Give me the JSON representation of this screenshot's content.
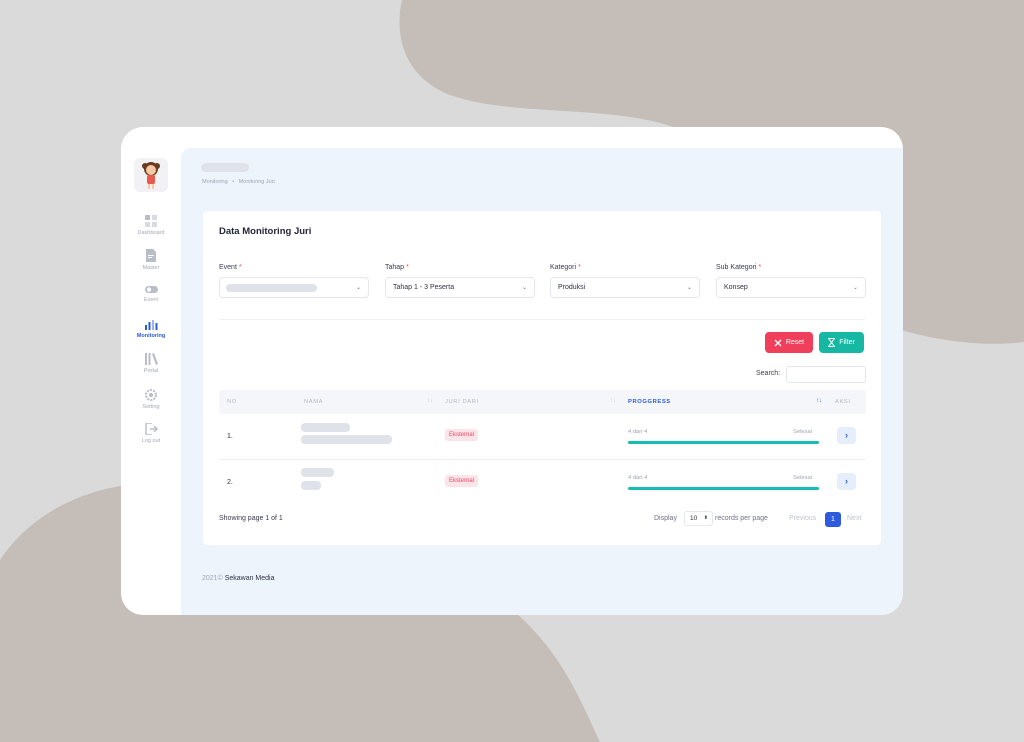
{
  "sidebar": {
    "items": [
      {
        "label": "Dashboard",
        "icon": "dashboard-icon"
      },
      {
        "label": "Master",
        "icon": "document-icon"
      },
      {
        "label": "Event",
        "icon": "toggle-icon"
      },
      {
        "label": "Monitoring",
        "icon": "bar-chart-icon",
        "active": true
      },
      {
        "label": "Portal",
        "icon": "library-icon"
      },
      {
        "label": "Setting",
        "icon": "gear-icon"
      },
      {
        "label": "Log out",
        "icon": "logout-icon"
      }
    ]
  },
  "breadcrumb": {
    "items": [
      "Monitoring",
      "•",
      "Monitoring Juri"
    ]
  },
  "card": {
    "title": "Data Monitoring Juri"
  },
  "filters": {
    "event": {
      "label": "Event",
      "value": ""
    },
    "tahap": {
      "label": "Tahap",
      "value": "Tahap 1 - 3 Peserta"
    },
    "kategori": {
      "label": "Kategori",
      "value": "Produksi"
    },
    "subkategori": {
      "label": "Sub Kategori",
      "value": "Konsep"
    },
    "required_mark": "*",
    "chevron": "⌄"
  },
  "buttons": {
    "reset": "Reset",
    "filter": "Filter"
  },
  "search": {
    "label": "Search:",
    "value": ""
  },
  "table": {
    "headers": {
      "no": "NO",
      "nama": "NAMA",
      "juri_dari": "JURI DARI",
      "progress": "PROGGRESS",
      "aksi": "AKSI"
    },
    "sort_icon": "↑↓",
    "rows": [
      {
        "no": "1.",
        "juri_dari": "Eksternal",
        "progress_left": "4 dari 4",
        "progress_right": "Selesai",
        "progress": 1.0,
        "action": "›"
      },
      {
        "no": "2.",
        "juri_dari": "Eksternal",
        "progress_left": "4 dari 4",
        "progress_right": "Selesai",
        "progress": 1.0,
        "action": "›"
      }
    ]
  },
  "pagination": {
    "showing": "Showing page 1 of 1",
    "display": "Display",
    "per_page": "10",
    "per_page_caret": "⬍",
    "records_per_page": "records per page",
    "previous": "Previous",
    "current": "1",
    "next": "Next"
  },
  "footer": {
    "year": "2021©",
    "company": "Sekawan Media"
  },
  "colors": {
    "accent": "#2d5bdb",
    "reset": "#ef3f5a",
    "filter": "#16b8a3",
    "progress": "#17bcb4",
    "badge": "#ef4760"
  }
}
